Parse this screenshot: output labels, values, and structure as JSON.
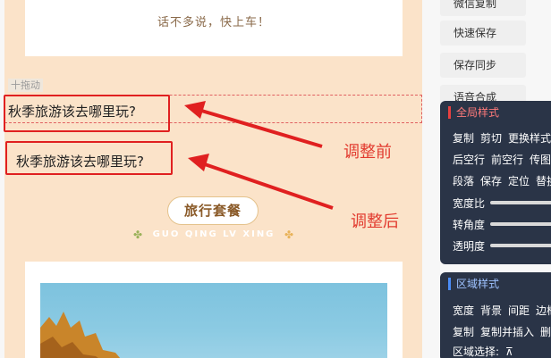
{
  "editor": {
    "intro_text": "话不多说，快上车！",
    "drag_label": "十拖动",
    "title_before": "秋季旅游该去哪里玩?",
    "title_after": "秋季旅游该去哪里玩?",
    "annotation_before": "调整前",
    "annotation_after": "调整后",
    "badge_label": "旅行套餐",
    "badge_pinyin": "GUO QING LV XING"
  },
  "colors": {
    "article_bg": "#fbe3c9",
    "annotation_red": "#e23b2f",
    "panel_dark": "#2a3447"
  },
  "right_panel": {
    "buttons": [
      "微信复制",
      "快速保存",
      "保存同步",
      "语音合成"
    ],
    "global_style": {
      "title": "全局样式",
      "row1": [
        "复制",
        "剪切",
        "更换样式"
      ],
      "row2": [
        "后空行",
        "前空行",
        "传图"
      ],
      "row3": [
        "段落",
        "保存",
        "定位",
        "替换"
      ],
      "sliders": [
        "宽度比",
        "转角度",
        "透明度"
      ]
    },
    "region_style": {
      "title": "区域样式",
      "row1": [
        "宽度",
        "背景",
        "间距",
        "边框"
      ],
      "row2": [
        "复制",
        "复制并插入",
        "删除"
      ],
      "select_label": "区域选择:"
    }
  }
}
